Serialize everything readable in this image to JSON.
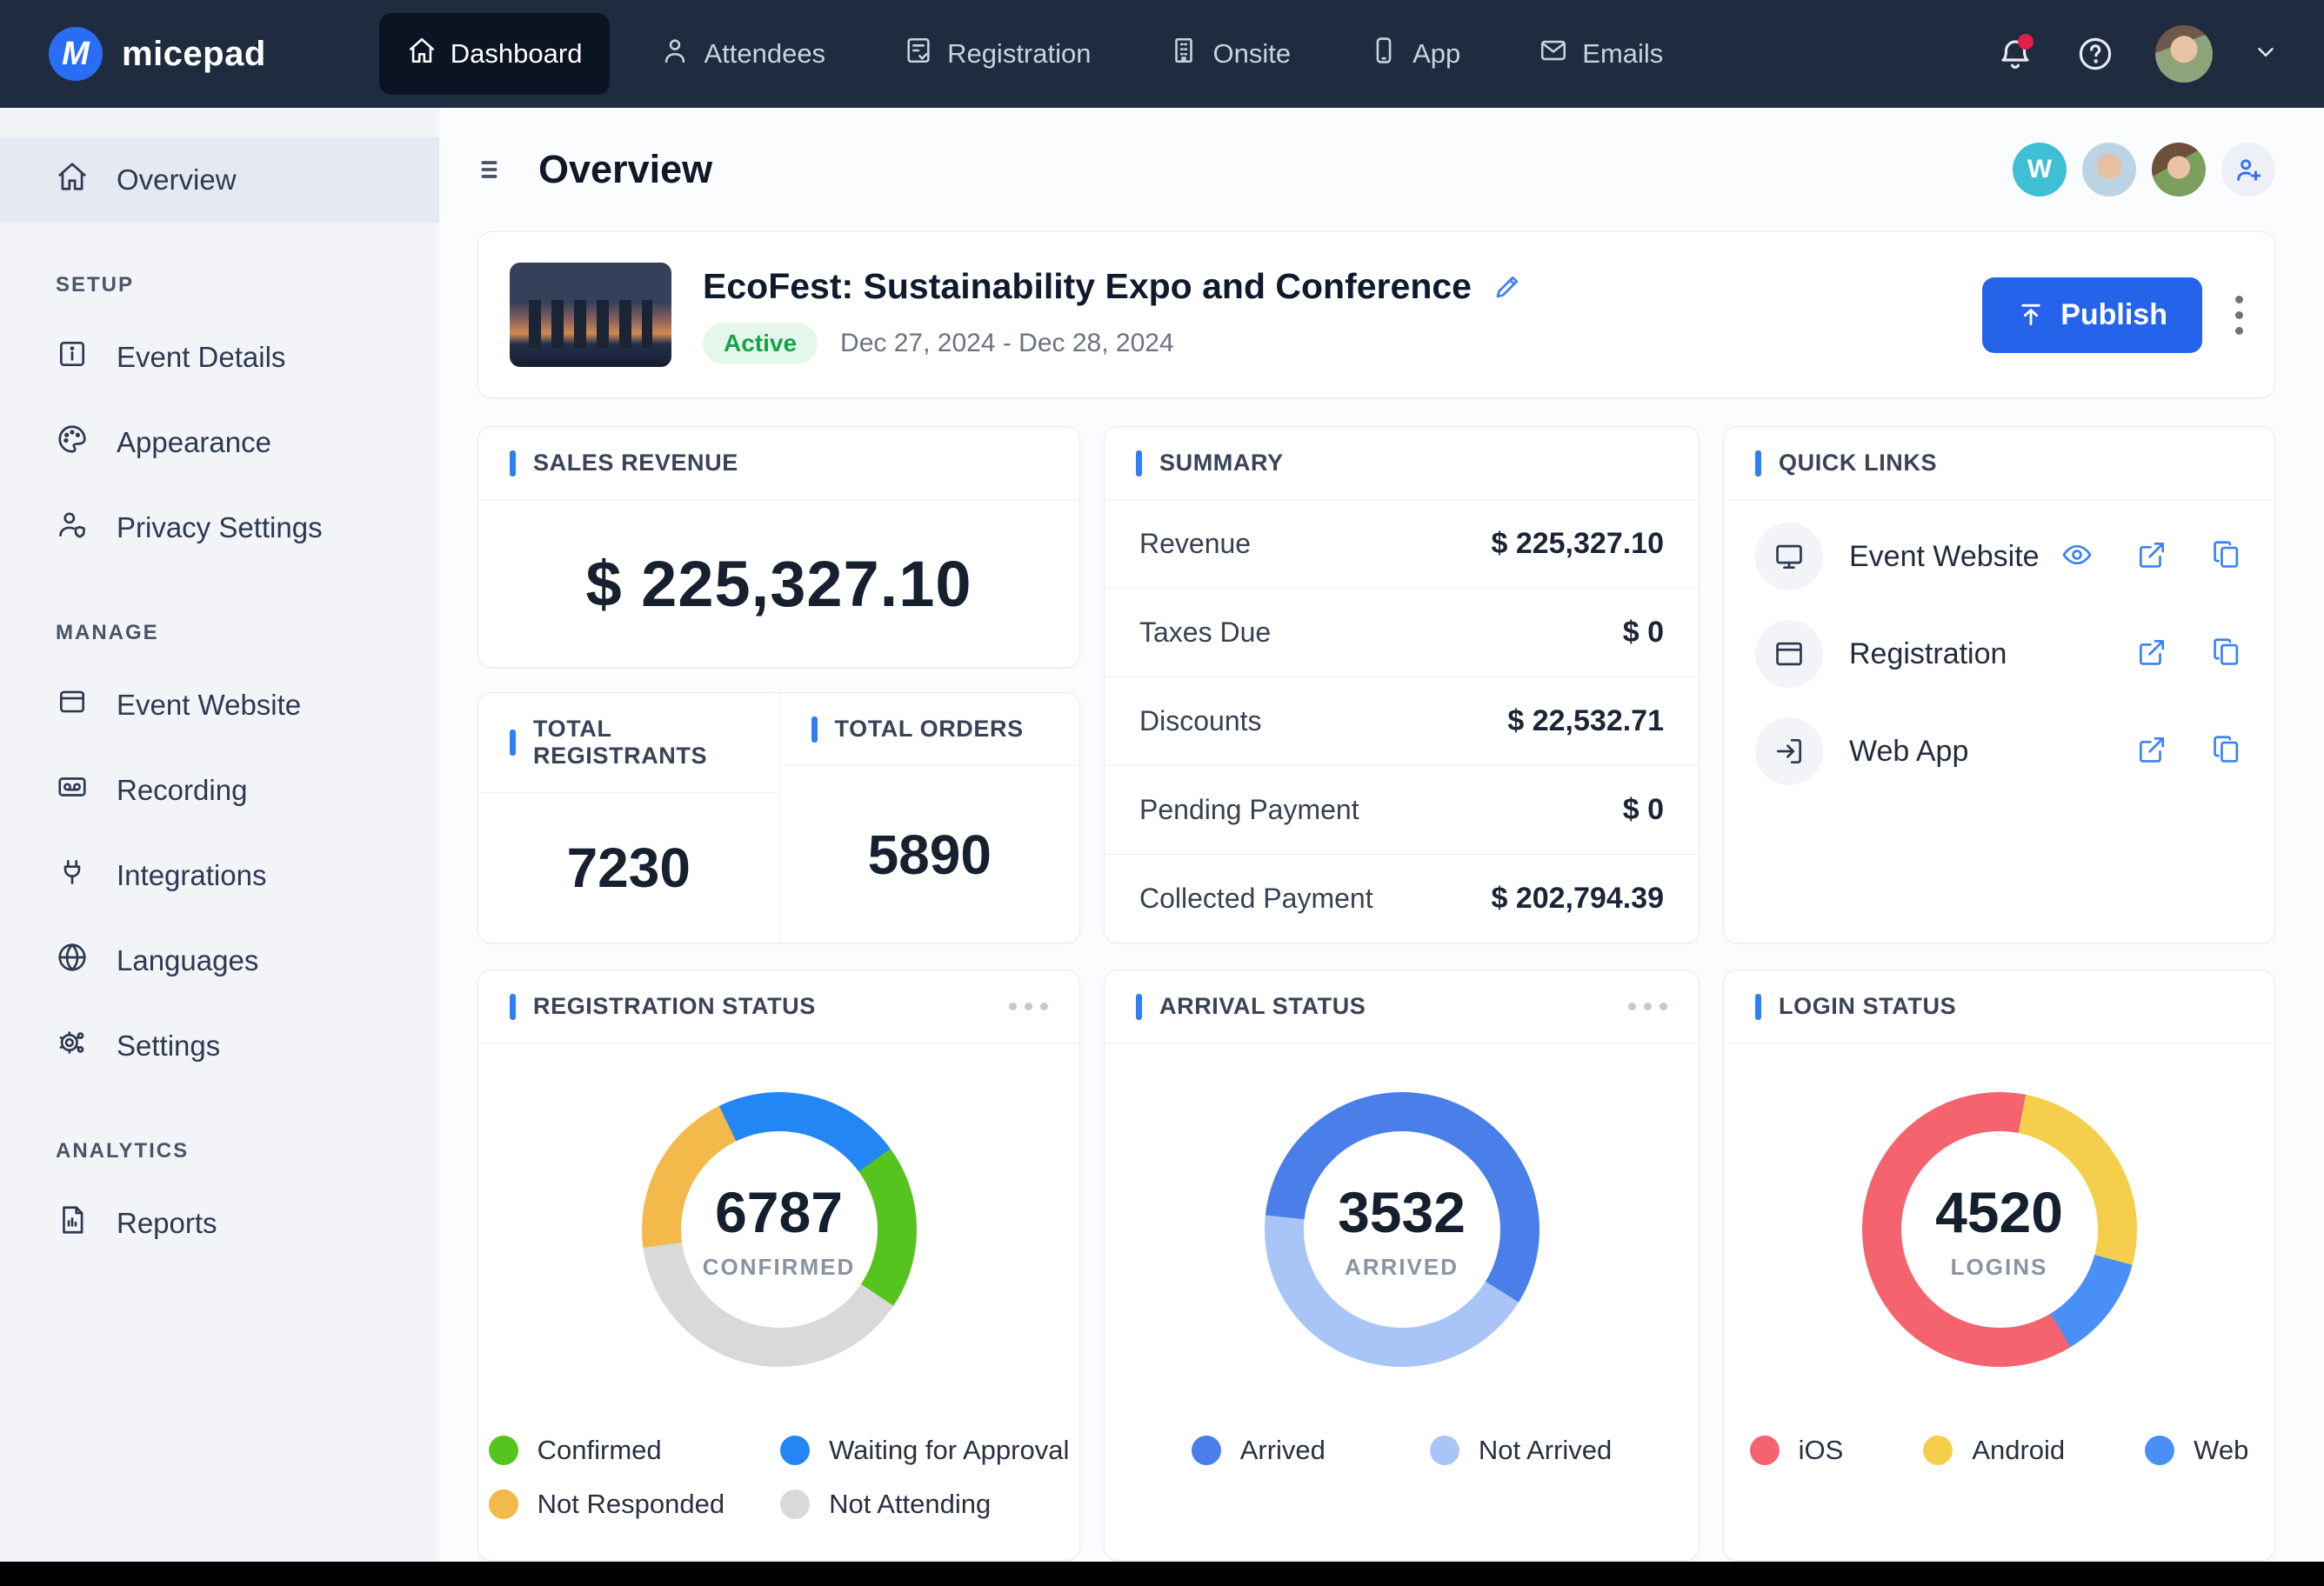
{
  "nav": {
    "brand": "micepad",
    "items": [
      {
        "label": "Dashboard",
        "active": true
      },
      {
        "label": "Attendees",
        "active": false
      },
      {
        "label": "Registration",
        "active": false
      },
      {
        "label": "Onsite",
        "active": false
      },
      {
        "label": "App",
        "active": false
      },
      {
        "label": "Emails",
        "active": false
      }
    ]
  },
  "sidebar": {
    "headings": [
      "SETUP",
      "MANAGE",
      "ANALYTICS"
    ],
    "items": [
      {
        "label": "Overview"
      },
      {
        "label": "Event Details"
      },
      {
        "label": "Appearance"
      },
      {
        "label": "Privacy Settings"
      },
      {
        "label": "Event Website"
      },
      {
        "label": "Recording"
      },
      {
        "label": "Integrations"
      },
      {
        "label": "Languages"
      },
      {
        "label": "Settings"
      },
      {
        "label": "Reports"
      }
    ]
  },
  "header": {
    "title": "Overview",
    "collaborator_initial": "W"
  },
  "event": {
    "title": "EcoFest: Sustainability Expo and Conference",
    "status": "Active",
    "dates": "Dec 27, 2024 - Dec 28, 2024",
    "publish_label": "Publish"
  },
  "cards": {
    "sales": {
      "title": "SALES REVENUE",
      "value": "$ 225,327.10"
    },
    "totals": {
      "registrants_title": "TOTAL REGISTRANTS",
      "registrants_value": "7230",
      "orders_title": "TOTAL ORDERS",
      "orders_value": "5890"
    },
    "summary": {
      "title": "SUMMARY",
      "rows": [
        {
          "label": "Revenue",
          "value": "$ 225,327.10"
        },
        {
          "label": "Taxes Due",
          "value": "$ 0"
        },
        {
          "label": "Discounts",
          "value": "$ 22,532.71"
        },
        {
          "label": "Pending Payment",
          "value": "$ 0"
        },
        {
          "label": "Collected Payment",
          "value": "$ 202,794.39"
        }
      ]
    },
    "quick_links": {
      "title": "QUICK LINKS",
      "links": [
        {
          "label": "Event Website"
        },
        {
          "label": "Registration"
        },
        {
          "label": "Web App"
        }
      ]
    }
  },
  "chart_data": [
    {
      "type": "donut",
      "title": "REGISTRATION STATUS",
      "center_value": "6787",
      "center_label": "CONFIRMED",
      "start_angle_deg": -26,
      "segments": [
        {
          "label": "Waiting for Approval",
          "color": "#2287f5",
          "percent": 22.2
        },
        {
          "label": "Confirmed",
          "color": "#55c41f",
          "percent": 19.4
        },
        {
          "label": "Not Attending",
          "color": "#d9d9d9",
          "percent": 38.5
        },
        {
          "label": "Not Responded",
          "color": "#f3b94a",
          "percent": 19.9
        }
      ],
      "legend": [
        {
          "label": "Confirmed",
          "color": "#55c41f"
        },
        {
          "label": "Waiting for Approval",
          "color": "#2287f5"
        },
        {
          "label": "Not Responded",
          "color": "#f3b94a"
        },
        {
          "label": "Not Attending",
          "color": "#d9d9d9"
        }
      ],
      "legend_position": "bottom"
    },
    {
      "type": "donut",
      "title": "ARRIVAL STATUS",
      "center_value": "3532",
      "center_label": "ARRIVED",
      "start_angle_deg": -84,
      "segments": [
        {
          "label": "Arrived",
          "color": "#4a7ee8",
          "percent": 57.2
        },
        {
          "label": "Not Arrived",
          "color": "#a9c4f7",
          "percent": 42.8
        }
      ],
      "legend": [
        {
          "label": "Arrived",
          "color": "#4a7ee8"
        },
        {
          "label": "Not Arrived",
          "color": "#a9c4f7"
        }
      ],
      "legend_position": "bottom"
    },
    {
      "type": "donut",
      "title": "LOGIN STATUS",
      "center_value": "4520",
      "center_label": "LOGINS",
      "start_angle_deg": 11,
      "segments": [
        {
          "label": "Android",
          "color": "#f5cf4b",
          "percent": 26.1
        },
        {
          "label": "Web",
          "color": "#4a8ff5",
          "percent": 12.2
        },
        {
          "label": "iOS",
          "color": "#f4636e",
          "percent": 61.7
        }
      ],
      "legend": [
        {
          "label": "iOS",
          "color": "#f4636e"
        },
        {
          "label": "Android",
          "color": "#f5cf4b"
        },
        {
          "label": "Web",
          "color": "#4a8ff5"
        }
      ],
      "legend_position": "bottom"
    }
  ],
  "colors": {
    "nav_bg": "#1f2b3f",
    "accent_blue": "#2f7ef6",
    "publish_blue": "#2563eb",
    "active_badge_green": "#17a34b",
    "sidebar_bg": "#f2f4f8"
  }
}
